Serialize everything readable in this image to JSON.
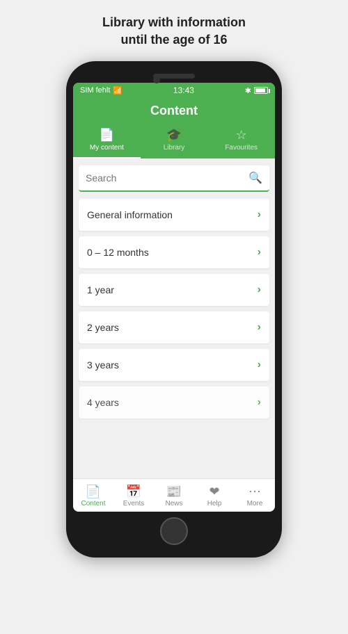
{
  "page": {
    "title_line1": "Library with information",
    "title_line2": "until the age of 16"
  },
  "status_bar": {
    "carrier": "SIM fehlt",
    "time": "13:43",
    "bluetooth": "✱"
  },
  "app_header": {
    "title": "Content"
  },
  "tabs": [
    {
      "id": "my-content",
      "label": "My content",
      "icon": "📄",
      "active": true
    },
    {
      "id": "library",
      "label": "Library",
      "icon": "🎓",
      "active": false
    },
    {
      "id": "favourites",
      "label": "Favourites",
      "icon": "☆",
      "active": false
    }
  ],
  "search": {
    "placeholder": "Search"
  },
  "list_items": [
    {
      "id": "general",
      "label": "General information"
    },
    {
      "id": "0-12",
      "label": "0 – 12 months"
    },
    {
      "id": "1-year",
      "label": "1 year"
    },
    {
      "id": "2-years",
      "label": "2 years"
    },
    {
      "id": "3-years",
      "label": "3 years"
    },
    {
      "id": "4-years",
      "label": "4 years"
    }
  ],
  "bottom_nav": [
    {
      "id": "content",
      "label": "Content",
      "icon": "📄",
      "active": true
    },
    {
      "id": "events",
      "label": "Events",
      "icon": "📅",
      "active": false
    },
    {
      "id": "news",
      "label": "News",
      "icon": "📰",
      "active": false
    },
    {
      "id": "help",
      "label": "Help",
      "icon": "❤",
      "active": false
    },
    {
      "id": "more",
      "label": "More",
      "icon": "···",
      "active": false
    }
  ],
  "colors": {
    "green": "#4caf50",
    "white": "#ffffff",
    "text_dark": "#333333",
    "text_light": "#999999"
  }
}
